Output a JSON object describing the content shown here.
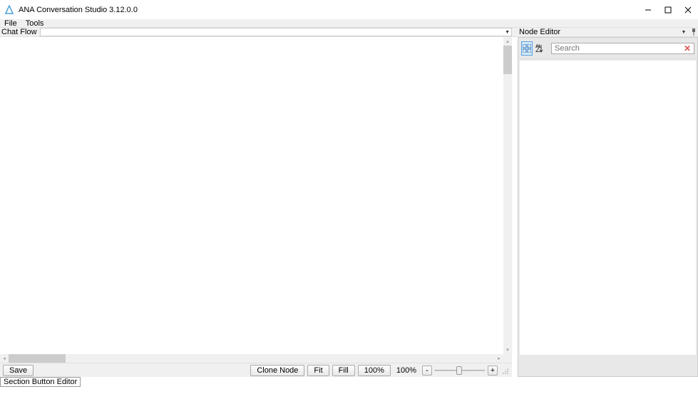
{
  "window": {
    "title": "ANA Conversation Studio 3.12.0.0"
  },
  "menu": {
    "file": "File",
    "tools": "Tools"
  },
  "chatflow": {
    "label": "Chat Flow",
    "selected": ""
  },
  "nodeEditor": {
    "label": "Node Editor",
    "searchPlaceholder": "Search"
  },
  "toolbar": {
    "save": "Save",
    "cloneNode": "Clone Node",
    "fit": "Fit",
    "fill": "Fill",
    "zoom100": "100%",
    "zoomCurrent": "100%",
    "zoomMinus": "-",
    "zoomPlus": "+"
  },
  "sectionTab": {
    "label": "Section Button Editor"
  },
  "icons": {
    "categorize": "categorize-icon",
    "sort": "sort-icon",
    "dropdown": "dropdown-icon",
    "pin": "pin-icon"
  }
}
